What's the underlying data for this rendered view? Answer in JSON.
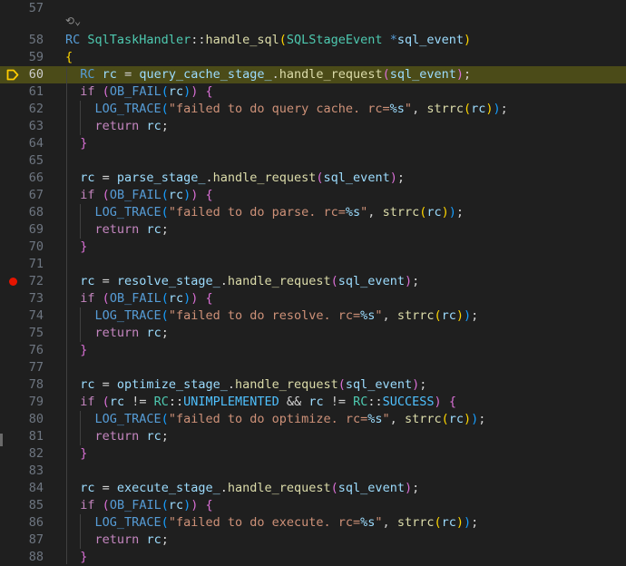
{
  "editor": {
    "codelens_icon": "refs-icon",
    "current_line": 60,
    "breakpoint_line": 72,
    "lines": [
      {
        "n": "57",
        "code": []
      },
      {
        "n": "58",
        "code": [
          [
            "t-kw",
            "RC"
          ],
          [
            "t-p",
            " "
          ],
          [
            "t-type",
            "SqlTaskHandler"
          ],
          [
            "t-p",
            "::"
          ],
          [
            "t-fn",
            "handle_sql"
          ],
          [
            "t-b1",
            "("
          ],
          [
            "t-type",
            "SQLStageEvent"
          ],
          [
            "t-p",
            " "
          ],
          [
            "t-kw",
            "*"
          ],
          [
            "t-var",
            "sql_event"
          ],
          [
            "t-b1",
            ")"
          ]
        ]
      },
      {
        "n": "59",
        "code": [
          [
            "t-b1",
            "{"
          ]
        ]
      },
      {
        "n": "60",
        "code": [
          [
            "t-p",
            "  "
          ],
          [
            "t-kw",
            "RC"
          ],
          [
            "t-p",
            " "
          ],
          [
            "t-var",
            "rc"
          ],
          [
            "t-p",
            " = "
          ],
          [
            "t-var",
            "query_cache_stage_"
          ],
          [
            "t-p",
            "."
          ],
          [
            "t-fn",
            "handle_request"
          ],
          [
            "t-b2",
            "("
          ],
          [
            "t-var",
            "sql_event"
          ],
          [
            "t-b2",
            ")"
          ],
          [
            "t-p",
            ";"
          ]
        ]
      },
      {
        "n": "61",
        "code": [
          [
            "t-p",
            "  "
          ],
          [
            "t-ctl",
            "if"
          ],
          [
            "t-p",
            " "
          ],
          [
            "t-b2",
            "("
          ],
          [
            "t-macro",
            "OB_FAIL"
          ],
          [
            "t-b3",
            "("
          ],
          [
            "t-var",
            "rc"
          ],
          [
            "t-b3",
            ")"
          ],
          [
            "t-b2",
            ")"
          ],
          [
            "t-p",
            " "
          ],
          [
            "t-b2",
            "{"
          ]
        ]
      },
      {
        "n": "62",
        "code": [
          [
            "t-p",
            "    "
          ],
          [
            "t-macro",
            "LOG_TRACE"
          ],
          [
            "t-b3",
            "("
          ],
          [
            "t-str",
            "\"failed to do query cache. rc="
          ],
          [
            "t-fmt",
            "%s"
          ],
          [
            "t-str",
            "\""
          ],
          [
            "t-p",
            ", "
          ],
          [
            "t-fn",
            "strrc"
          ],
          [
            "t-b1",
            "("
          ],
          [
            "t-var",
            "rc"
          ],
          [
            "t-b1",
            ")"
          ],
          [
            "t-b3",
            ")"
          ],
          [
            "t-p",
            ";"
          ]
        ]
      },
      {
        "n": "63",
        "code": [
          [
            "t-p",
            "    "
          ],
          [
            "t-ctl",
            "return"
          ],
          [
            "t-p",
            " "
          ],
          [
            "t-var",
            "rc"
          ],
          [
            "t-p",
            ";"
          ]
        ]
      },
      {
        "n": "64",
        "code": [
          [
            "t-p",
            "  "
          ],
          [
            "t-b2",
            "}"
          ]
        ]
      },
      {
        "n": "65",
        "code": []
      },
      {
        "n": "66",
        "code": [
          [
            "t-p",
            "  "
          ],
          [
            "t-var",
            "rc"
          ],
          [
            "t-p",
            " = "
          ],
          [
            "t-var",
            "parse_stage_"
          ],
          [
            "t-p",
            "."
          ],
          [
            "t-fn",
            "handle_request"
          ],
          [
            "t-b2",
            "("
          ],
          [
            "t-var",
            "sql_event"
          ],
          [
            "t-b2",
            ")"
          ],
          [
            "t-p",
            ";"
          ]
        ]
      },
      {
        "n": "67",
        "code": [
          [
            "t-p",
            "  "
          ],
          [
            "t-ctl",
            "if"
          ],
          [
            "t-p",
            " "
          ],
          [
            "t-b2",
            "("
          ],
          [
            "t-macro",
            "OB_FAIL"
          ],
          [
            "t-b3",
            "("
          ],
          [
            "t-var",
            "rc"
          ],
          [
            "t-b3",
            ")"
          ],
          [
            "t-b2",
            ")"
          ],
          [
            "t-p",
            " "
          ],
          [
            "t-b2",
            "{"
          ]
        ]
      },
      {
        "n": "68",
        "code": [
          [
            "t-p",
            "    "
          ],
          [
            "t-macro",
            "LOG_TRACE"
          ],
          [
            "t-b3",
            "("
          ],
          [
            "t-str",
            "\"failed to do parse. rc="
          ],
          [
            "t-fmt",
            "%s"
          ],
          [
            "t-str",
            "\""
          ],
          [
            "t-p",
            ", "
          ],
          [
            "t-fn",
            "strrc"
          ],
          [
            "t-b1",
            "("
          ],
          [
            "t-var",
            "rc"
          ],
          [
            "t-b1",
            ")"
          ],
          [
            "t-b3",
            ")"
          ],
          [
            "t-p",
            ";"
          ]
        ]
      },
      {
        "n": "69",
        "code": [
          [
            "t-p",
            "    "
          ],
          [
            "t-ctl",
            "return"
          ],
          [
            "t-p",
            " "
          ],
          [
            "t-var",
            "rc"
          ],
          [
            "t-p",
            ";"
          ]
        ]
      },
      {
        "n": "70",
        "code": [
          [
            "t-p",
            "  "
          ],
          [
            "t-b2",
            "}"
          ]
        ]
      },
      {
        "n": "71",
        "code": []
      },
      {
        "n": "72",
        "code": [
          [
            "t-p",
            "  "
          ],
          [
            "t-var",
            "rc"
          ],
          [
            "t-p",
            " = "
          ],
          [
            "t-var",
            "resolve_stage_"
          ],
          [
            "t-p",
            "."
          ],
          [
            "t-fn",
            "handle_request"
          ],
          [
            "t-b2",
            "("
          ],
          [
            "t-var",
            "sql_event"
          ],
          [
            "t-b2",
            ")"
          ],
          [
            "t-p",
            ";"
          ]
        ]
      },
      {
        "n": "73",
        "code": [
          [
            "t-p",
            "  "
          ],
          [
            "t-ctl",
            "if"
          ],
          [
            "t-p",
            " "
          ],
          [
            "t-b2",
            "("
          ],
          [
            "t-macro",
            "OB_FAIL"
          ],
          [
            "t-b3",
            "("
          ],
          [
            "t-var",
            "rc"
          ],
          [
            "t-b3",
            ")"
          ],
          [
            "t-b2",
            ")"
          ],
          [
            "t-p",
            " "
          ],
          [
            "t-b2",
            "{"
          ]
        ]
      },
      {
        "n": "74",
        "code": [
          [
            "t-p",
            "    "
          ],
          [
            "t-macro",
            "LOG_TRACE"
          ],
          [
            "t-b3",
            "("
          ],
          [
            "t-str",
            "\"failed to do resolve. rc="
          ],
          [
            "t-fmt",
            "%s"
          ],
          [
            "t-str",
            "\""
          ],
          [
            "t-p",
            ", "
          ],
          [
            "t-fn",
            "strrc"
          ],
          [
            "t-b1",
            "("
          ],
          [
            "t-var",
            "rc"
          ],
          [
            "t-b1",
            ")"
          ],
          [
            "t-b3",
            ")"
          ],
          [
            "t-p",
            ";"
          ]
        ]
      },
      {
        "n": "75",
        "code": [
          [
            "t-p",
            "    "
          ],
          [
            "t-ctl",
            "return"
          ],
          [
            "t-p",
            " "
          ],
          [
            "t-var",
            "rc"
          ],
          [
            "t-p",
            ";"
          ]
        ]
      },
      {
        "n": "76",
        "code": [
          [
            "t-p",
            "  "
          ],
          [
            "t-b2",
            "}"
          ]
        ]
      },
      {
        "n": "77",
        "code": []
      },
      {
        "n": "78",
        "code": [
          [
            "t-p",
            "  "
          ],
          [
            "t-var",
            "rc"
          ],
          [
            "t-p",
            " = "
          ],
          [
            "t-var",
            "optimize_stage_"
          ],
          [
            "t-p",
            "."
          ],
          [
            "t-fn",
            "handle_request"
          ],
          [
            "t-b2",
            "("
          ],
          [
            "t-var",
            "sql_event"
          ],
          [
            "t-b2",
            ")"
          ],
          [
            "t-p",
            ";"
          ]
        ]
      },
      {
        "n": "79",
        "code": [
          [
            "t-p",
            "  "
          ],
          [
            "t-ctl",
            "if"
          ],
          [
            "t-p",
            " "
          ],
          [
            "t-b2",
            "("
          ],
          [
            "t-var",
            "rc"
          ],
          [
            "t-p",
            " != "
          ],
          [
            "t-type",
            "RC"
          ],
          [
            "t-p",
            "::"
          ],
          [
            "t-enum",
            "UNIMPLEMENTED"
          ],
          [
            "t-p",
            " && "
          ],
          [
            "t-var",
            "rc"
          ],
          [
            "t-p",
            " != "
          ],
          [
            "t-type",
            "RC"
          ],
          [
            "t-p",
            "::"
          ],
          [
            "t-enum",
            "SUCCESS"
          ],
          [
            "t-b2",
            ")"
          ],
          [
            "t-p",
            " "
          ],
          [
            "t-b2",
            "{"
          ]
        ]
      },
      {
        "n": "80",
        "code": [
          [
            "t-p",
            "    "
          ],
          [
            "t-macro",
            "LOG_TRACE"
          ],
          [
            "t-b3",
            "("
          ],
          [
            "t-str",
            "\"failed to do optimize. rc="
          ],
          [
            "t-fmt",
            "%s"
          ],
          [
            "t-str",
            "\""
          ],
          [
            "t-p",
            ", "
          ],
          [
            "t-fn",
            "strrc"
          ],
          [
            "t-b1",
            "("
          ],
          [
            "t-var",
            "rc"
          ],
          [
            "t-b1",
            ")"
          ],
          [
            "t-b3",
            ")"
          ],
          [
            "t-p",
            ";"
          ]
        ]
      },
      {
        "n": "81",
        "code": [
          [
            "t-p",
            "    "
          ],
          [
            "t-ctl",
            "return"
          ],
          [
            "t-p",
            " "
          ],
          [
            "t-var",
            "rc"
          ],
          [
            "t-p",
            ";"
          ]
        ]
      },
      {
        "n": "82",
        "code": [
          [
            "t-p",
            "  "
          ],
          [
            "t-b2",
            "}"
          ]
        ]
      },
      {
        "n": "83",
        "code": []
      },
      {
        "n": "84",
        "code": [
          [
            "t-p",
            "  "
          ],
          [
            "t-var",
            "rc"
          ],
          [
            "t-p",
            " = "
          ],
          [
            "t-var",
            "execute_stage_"
          ],
          [
            "t-p",
            "."
          ],
          [
            "t-fn",
            "handle_request"
          ],
          [
            "t-b2",
            "("
          ],
          [
            "t-var",
            "sql_event"
          ],
          [
            "t-b2",
            ")"
          ],
          [
            "t-p",
            ";"
          ]
        ]
      },
      {
        "n": "85",
        "code": [
          [
            "t-p",
            "  "
          ],
          [
            "t-ctl",
            "if"
          ],
          [
            "t-p",
            " "
          ],
          [
            "t-b2",
            "("
          ],
          [
            "t-macro",
            "OB_FAIL"
          ],
          [
            "t-b3",
            "("
          ],
          [
            "t-var",
            "rc"
          ],
          [
            "t-b3",
            ")"
          ],
          [
            "t-b2",
            ")"
          ],
          [
            "t-p",
            " "
          ],
          [
            "t-b2",
            "{"
          ]
        ]
      },
      {
        "n": "86",
        "code": [
          [
            "t-p",
            "    "
          ],
          [
            "t-macro",
            "LOG_TRACE"
          ],
          [
            "t-b3",
            "("
          ],
          [
            "t-str",
            "\"failed to do execute. rc="
          ],
          [
            "t-fmt",
            "%s"
          ],
          [
            "t-str",
            "\""
          ],
          [
            "t-p",
            ", "
          ],
          [
            "t-fn",
            "strrc"
          ],
          [
            "t-b1",
            "("
          ],
          [
            "t-var",
            "rc"
          ],
          [
            "t-b1",
            ")"
          ],
          [
            "t-b3",
            ")"
          ],
          [
            "t-p",
            ";"
          ]
        ]
      },
      {
        "n": "87",
        "code": [
          [
            "t-p",
            "    "
          ],
          [
            "t-ctl",
            "return"
          ],
          [
            "t-p",
            " "
          ],
          [
            "t-var",
            "rc"
          ],
          [
            "t-p",
            ";"
          ]
        ]
      },
      {
        "n": "88",
        "code": [
          [
            "t-p",
            "  "
          ],
          [
            "t-b2",
            "}"
          ]
        ]
      }
    ]
  }
}
